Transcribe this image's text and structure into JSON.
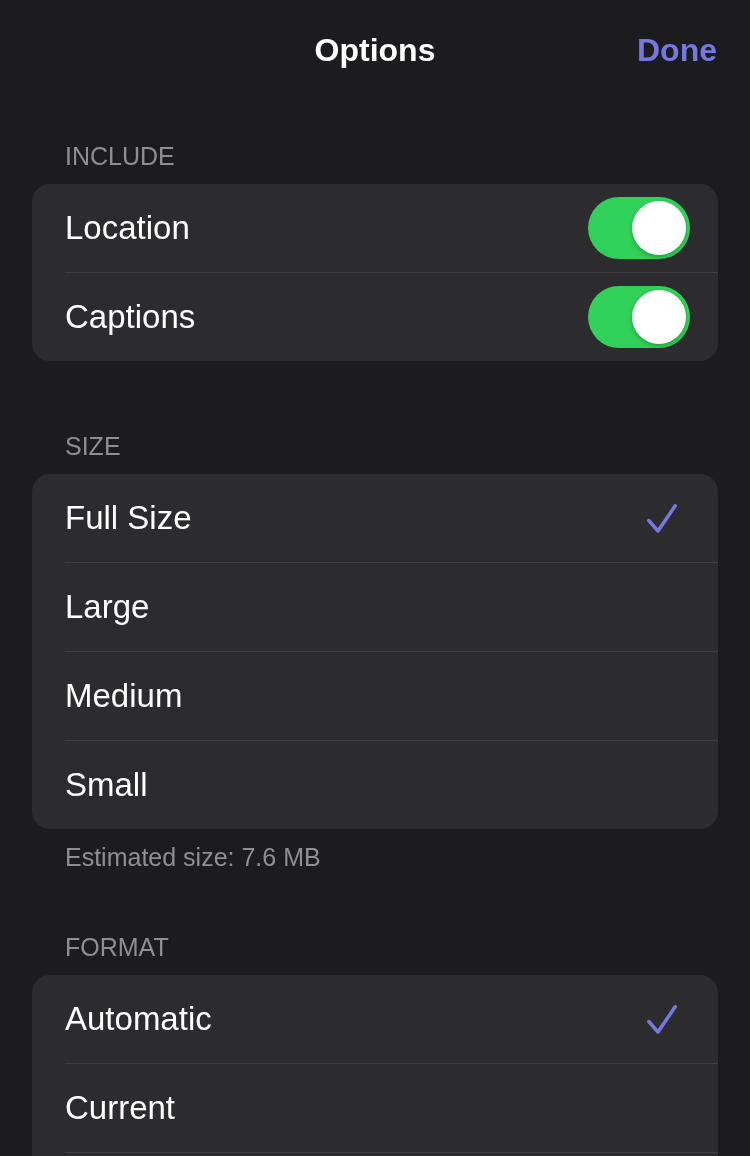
{
  "nav": {
    "title": "Options",
    "done_button": "Done"
  },
  "sections": [
    {
      "header": "INCLUDE",
      "rows": [
        {
          "kind": "toggle",
          "label": "Location",
          "on": true
        },
        {
          "kind": "toggle",
          "label": "Captions",
          "on": true
        }
      ]
    },
    {
      "header": "SIZE",
      "rows": [
        {
          "kind": "choice",
          "label": "Full Size",
          "selected": true
        },
        {
          "kind": "choice",
          "label": "Large",
          "selected": false
        },
        {
          "kind": "choice",
          "label": "Medium",
          "selected": false
        },
        {
          "kind": "choice",
          "label": "Small",
          "selected": false
        }
      ],
      "footer": "Estimated size: 7.6 MB"
    },
    {
      "header": "FORMAT",
      "rows": [
        {
          "kind": "choice",
          "label": "Automatic",
          "selected": true
        },
        {
          "kind": "choice",
          "label": "Current",
          "selected": false
        }
      ],
      "continues_below": true
    }
  ]
}
